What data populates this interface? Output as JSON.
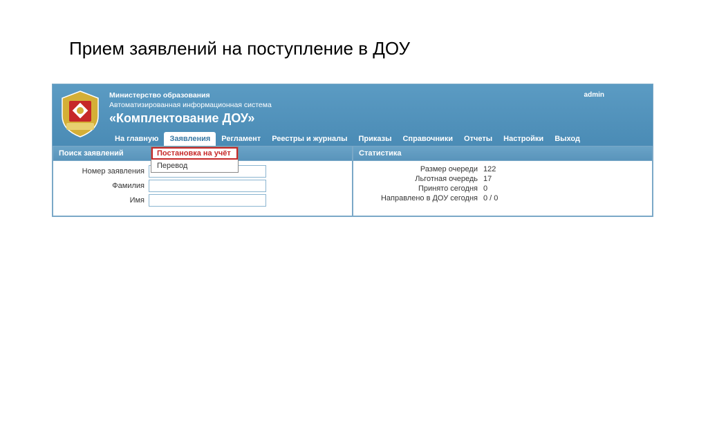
{
  "page": {
    "title": "Прием заявлений на поступление в ДОУ"
  },
  "header": {
    "ministry": "Министерство образования",
    "ais": "Автоматизированная информационная система",
    "system_name": "«Комплектование ДОУ»",
    "user": "admin"
  },
  "nav": {
    "items": [
      "На главную",
      "Заявления",
      "Регламент",
      "Реестры и журналы",
      "Приказы",
      "Справочники",
      "Отчеты",
      "Настройки",
      "Выход"
    ],
    "active_index": 1
  },
  "dropdown": {
    "items": [
      "Постановка на учёт",
      "Перевод"
    ],
    "highlighted_index": 0
  },
  "search_panel": {
    "title": "Поиск заявлений",
    "fields": {
      "number": {
        "label": "Номер заявления",
        "value": ""
      },
      "surname": {
        "label": "Фамилия",
        "value": ""
      },
      "name": {
        "label": "Имя",
        "value": ""
      }
    }
  },
  "stats_panel": {
    "title": "Статистика",
    "rows": [
      {
        "label": "Размер очереди",
        "value": "122"
      },
      {
        "label": "Льготная очередь",
        "value": "17"
      },
      {
        "label": "Принято сегодня",
        "value": "0"
      },
      {
        "label": "Направлено в ДОУ сегодня",
        "value": "0 / 0"
      }
    ]
  }
}
